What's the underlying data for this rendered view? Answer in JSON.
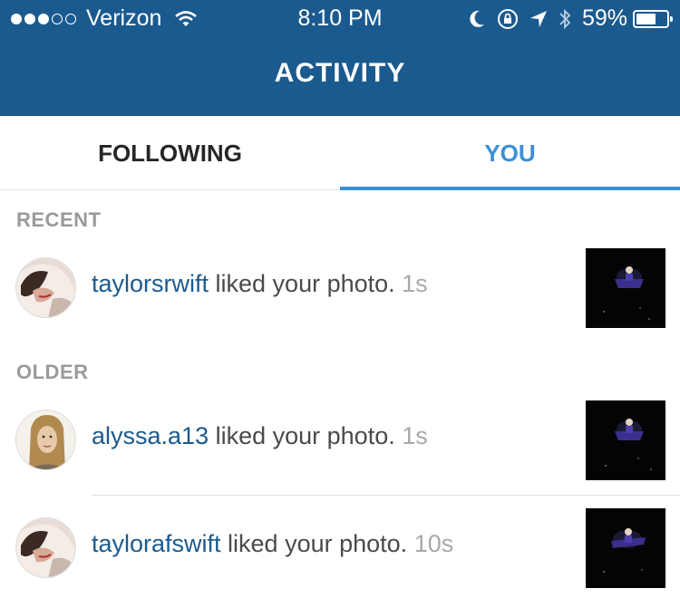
{
  "status_bar": {
    "carrier": "Verizon",
    "time": "8:10 PM",
    "battery_percent": "59%",
    "battery_level": 0.59,
    "signal_bars_filled": 3,
    "signal_bars_total": 5,
    "icons": [
      "wifi-icon",
      "moon-icon",
      "rotation-lock-icon",
      "location-arrow-icon",
      "bluetooth-icon",
      "battery-icon"
    ]
  },
  "header": {
    "title": "ACTIVITY"
  },
  "tabs": [
    {
      "label": "FOLLOWING",
      "active": false
    },
    {
      "label": "YOU",
      "active": true
    }
  ],
  "sections": [
    {
      "title": "RECENT",
      "items": [
        {
          "username": "taylorsrwift",
          "action": " liked your photo. ",
          "time": "1s"
        }
      ]
    },
    {
      "title": "OLDER",
      "items": [
        {
          "username": "alyssa.a13",
          "action": " liked your photo. ",
          "time": "1s"
        },
        {
          "username": "taylorafswift",
          "action": " liked your photo. ",
          "time": "10s"
        }
      ]
    }
  ],
  "colors": {
    "header_bg": "#1b5a8f",
    "active_tab": "#3b8fd6",
    "username": "#1b5a8f",
    "muted": "#a9a9a9"
  }
}
